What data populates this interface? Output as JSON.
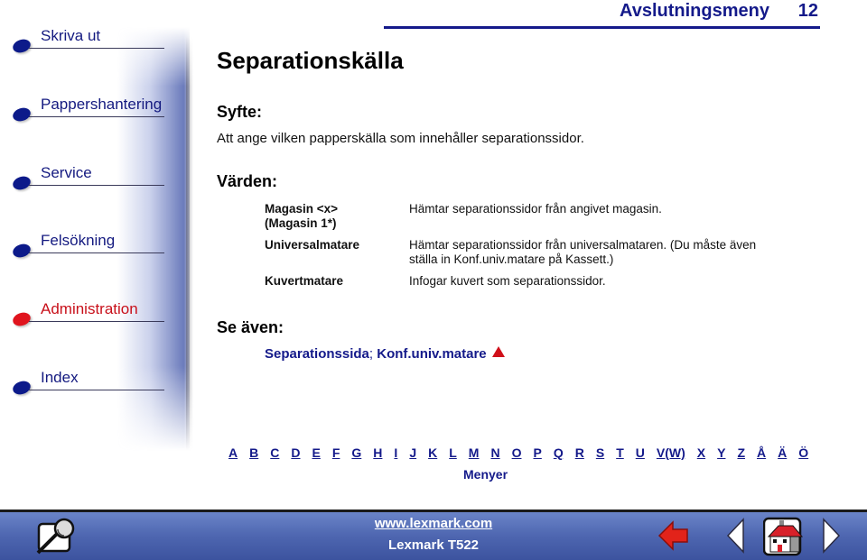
{
  "sidebar": {
    "items": [
      {
        "label": "Skriva ut",
        "active": false
      },
      {
        "label": "Pappershantering",
        "active": false
      },
      {
        "label": "Service",
        "active": false
      },
      {
        "label": "Felsökning",
        "active": false
      },
      {
        "label": "Administration",
        "active": true
      },
      {
        "label": "Index",
        "active": false
      }
    ]
  },
  "header": {
    "section_title": "Avslutningsmeny",
    "page_number": "12"
  },
  "main": {
    "title": "Separationskälla",
    "purpose_heading": "Syfte:",
    "purpose_text": "Att ange vilken papperskälla som innehåller separationssidor.",
    "values_heading": "Värden:",
    "values": [
      {
        "term_line1": "Magasin <x>",
        "term_line2": "(Magasin 1*)",
        "desc_line1": "Hämtar separationssidor från angivet magasin.",
        "desc_line2": ""
      },
      {
        "term_line1": "Universalmatare",
        "term_line2": "",
        "desc_line1": "Hämtar separationssidor från universalmataren. (Du måste även",
        "desc_line2": "ställa in Konf.univ.matare på Kassett.)"
      },
      {
        "term_line1": "Kuvertmatare",
        "term_line2": "",
        "desc_line1": "Infogar kuvert som separationssidor.",
        "desc_line2": ""
      }
    ],
    "see_also_heading": "Se även:",
    "see_also_links": [
      "Separationssida",
      "Konf.univ.matare"
    ],
    "see_also_separator": "; "
  },
  "alphabet": [
    "A",
    "B",
    "C",
    "D",
    "E",
    "F",
    "G",
    "H",
    "I",
    "J",
    "K",
    "L",
    "M",
    "N",
    "O",
    "P",
    "Q",
    "R",
    "S",
    "T",
    "U",
    "V(W)",
    "X",
    "Y",
    "Z",
    "Å",
    "Ä",
    "Ö"
  ],
  "menus_link": "Menyer",
  "footer": {
    "url": "www.lexmark.com",
    "model": "Lexmark T522",
    "icons": [
      "search-icon",
      "back-arrow-icon",
      "previous-page-icon",
      "home-icon",
      "next-page-icon"
    ]
  },
  "colors": {
    "nav_text": "#141a80",
    "active_accent": "#c8101a",
    "footer_bg": "#4e66b0"
  }
}
